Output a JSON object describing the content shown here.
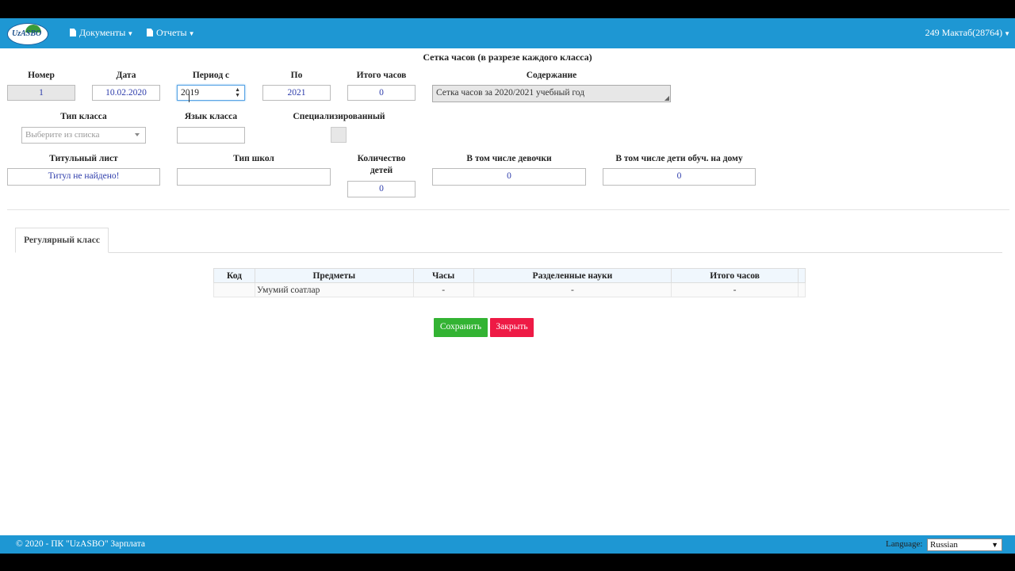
{
  "nav": {
    "logo_text": "UzASBO",
    "documents": "Документы",
    "reports": "Отчеты",
    "user": "249 Мактаб(28764)"
  },
  "title": "Сетка часов (в разрезе каждого класса)",
  "form": {
    "number_label": "Номер",
    "number_value": "1",
    "date_label": "Дата",
    "date_value": "10.02.2020",
    "period_from_label": "Период с",
    "period_from_value": "2019",
    "period_to_label": "По",
    "period_to_value": "2021",
    "total_hours_label": "Итого часов",
    "total_hours_value": "0",
    "content_label": "Содержание",
    "content_value": "Сетка часов за 2020/2021 учебный год",
    "class_type_label": "Тип класса",
    "class_type_placeholder": "Выберите из списка",
    "class_lang_label": "Язык класса",
    "class_lang_value": "",
    "specialized_label": "Специализированный",
    "title_sheet_label": "Титульный лист",
    "title_sheet_value": "Титул не найдено!",
    "school_type_label": "Тип школ",
    "school_type_value": "",
    "children_count_label_1": "Количество",
    "children_count_label_2": "детей",
    "children_count_value": "0",
    "girls_label": "В том числе девочки",
    "girls_value": "0",
    "home_label": "В том числе дети обуч. на дому",
    "home_value": "0"
  },
  "tabs": [
    {
      "label": "Регулярный класс"
    }
  ],
  "table": {
    "headers": [
      "Код",
      "Предметы",
      "Часы",
      "Разделенные науки",
      "Итого часов"
    ],
    "rows": [
      [
        "",
        "Умумий соатлар",
        "-",
        "-",
        "-"
      ]
    ]
  },
  "buttons": {
    "save": "Сохранить",
    "close": "Закрыть"
  },
  "footer": {
    "copyright": "© 2020 - ПК \"UzASBO\" Зарплата",
    "language_label": "Language:",
    "language_value": "Russian"
  },
  "colors": {
    "primary": "#1e97d3",
    "save": "#33b333",
    "close": "#ee1a45",
    "value_text": "#2d3cab"
  }
}
